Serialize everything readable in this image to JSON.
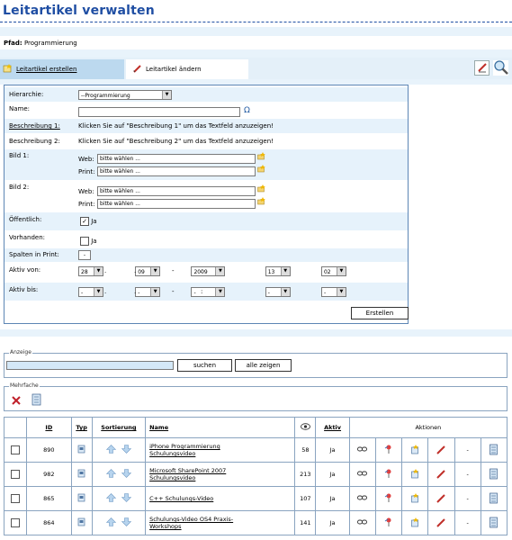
{
  "title": "Leitartikel verwalten",
  "path": {
    "label": "Pfad:",
    "value": "Programmierung"
  },
  "tabs": [
    {
      "label": "Leitartikel erstellen"
    },
    {
      "label": "Leitartikel ändern"
    }
  ],
  "form": {
    "hierarchie": {
      "label": "Hierarchie:",
      "value": "--Programmierung"
    },
    "name": {
      "label": "Name:",
      "value": ""
    },
    "beschreibung1": {
      "label": "Beschreibung 1:",
      "text": "Klicken Sie auf \"Beschreibung 1\" um das Textfeld anzuzeigen!"
    },
    "beschreibung2": {
      "label": "Beschreibung 2:",
      "text": "Klicken Sie auf \"Beschreibung 2\" um das Textfeld anzuzeigen!"
    },
    "bild1": {
      "label": "Bild 1:",
      "web_label": "Web:",
      "print_label": "Print:",
      "web_value": "bitte wählen ...",
      "print_value": "bitte wählen ..."
    },
    "bild2": {
      "label": "Bild 2:",
      "web_label": "Web:",
      "print_label": "Print:",
      "web_value": "bitte wählen ...",
      "print_value": "bitte wählen ..."
    },
    "oeffentlich": {
      "label": "Öffentlich:",
      "checked": true,
      "option": "Ja"
    },
    "vorhanden": {
      "label": "Vorhanden:",
      "checked": false,
      "option": "Ja"
    },
    "spalten": {
      "label": "Spalten in Print:",
      "value": "-"
    },
    "aktiv_von": {
      "label": "Aktiv von:",
      "day": "28",
      "month": "09",
      "year": "2009",
      "hour": "13",
      "minute": "02"
    },
    "aktiv_bis": {
      "label": "Aktiv bis:",
      "day": "-",
      "month": "-",
      "year": "-",
      "hour": "-",
      "minute": "-"
    },
    "submit_label": "Erstellen"
  },
  "anzeige": {
    "legend": "Anzeige",
    "search_value": "",
    "search_button": "suchen",
    "show_all_button": "alle zeigen"
  },
  "mehrfach": {
    "legend": "Mehrfache"
  },
  "table": {
    "headers": {
      "id": "ID",
      "typ": "Typ",
      "sortierung": "Sortierung",
      "name": "Name",
      "aktiv": "Aktiv",
      "aktionen": "Aktionen"
    },
    "rows": [
      {
        "id": "890",
        "name_line1": "iPhone Programmierung",
        "name_line2": "Schulungsvideo",
        "views": "58",
        "aktiv": "Ja",
        "dash": "-"
      },
      {
        "id": "982",
        "name_line1": "Microsoft SharePoint 2007",
        "name_line2": "Schulungsvideo",
        "views": "213",
        "aktiv": "Ja",
        "dash": "-"
      },
      {
        "id": "865",
        "name_line1": "C++ Schulungs-Video",
        "name_line2": "",
        "views": "107",
        "aktiv": "Ja",
        "dash": "-"
      },
      {
        "id": "864",
        "name_line1": "Schulungs-Video OS4 Praxis-",
        "name_line2": "Workshops",
        "views": "141",
        "aktiv": "Ja",
        "dash": "-"
      }
    ]
  }
}
